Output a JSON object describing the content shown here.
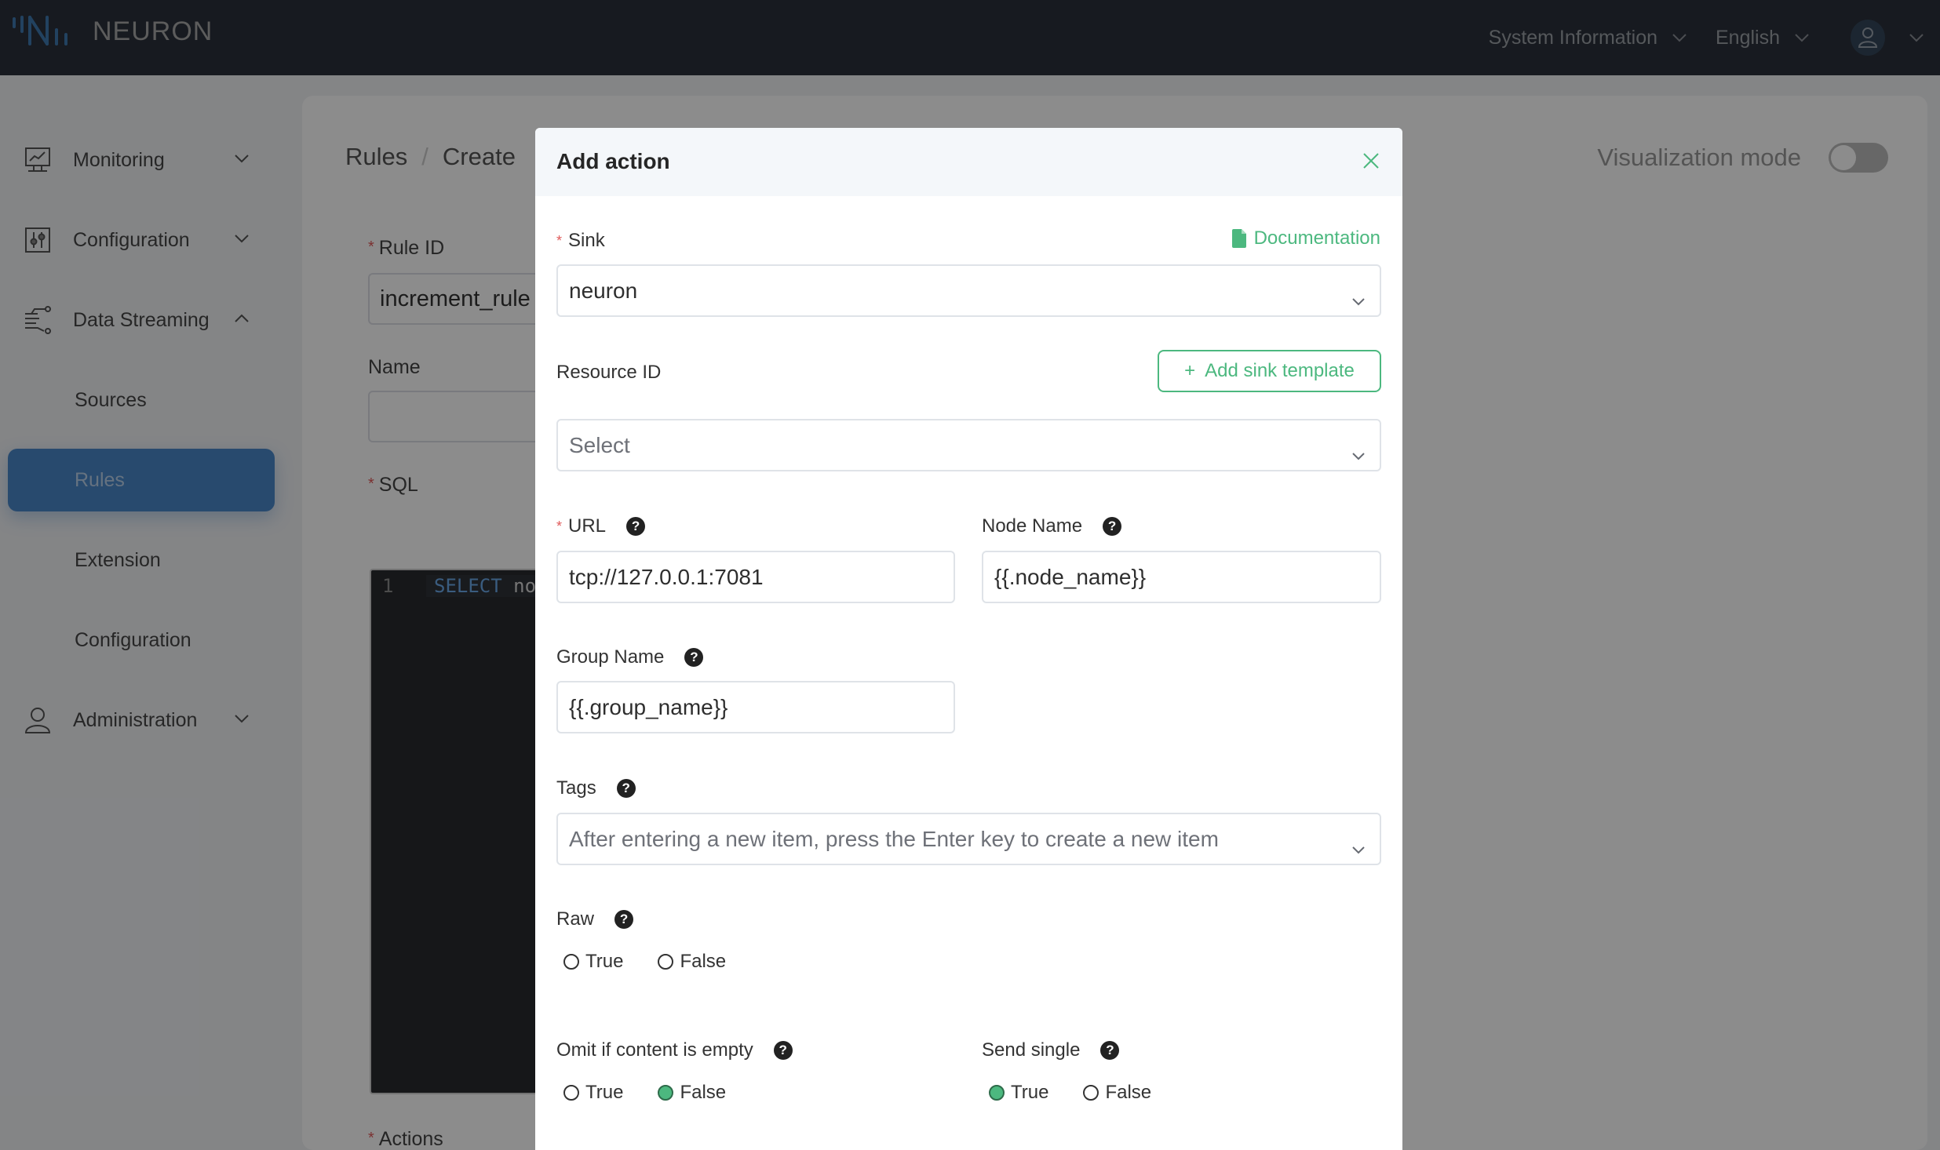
{
  "header": {
    "app_name": "NEURON",
    "menus": [
      {
        "label": "System Information"
      },
      {
        "label": "English"
      }
    ],
    "user_icon": "user-icon"
  },
  "sidebar": {
    "items": [
      {
        "label": "Monitoring",
        "icon": "monitor-chart-icon",
        "expanded": false
      },
      {
        "label": "Configuration",
        "icon": "sliders-icon",
        "expanded": false
      },
      {
        "label": "Data Streaming",
        "icon": "data-stream-icon",
        "expanded": true
      },
      {
        "label": "Sources",
        "sub": true
      },
      {
        "label": "Rules",
        "sub": true,
        "active": true
      },
      {
        "label": "Extension",
        "sub": true
      },
      {
        "label": "Configuration",
        "sub": true
      },
      {
        "label": "Administration",
        "icon": "user-icon",
        "expanded": false
      }
    ]
  },
  "page": {
    "breadcrumb": [
      "Rules",
      "Create"
    ],
    "breadcrumb_sep": "/",
    "visualization_mode_label": "Visualization mode",
    "visualization_mode_on": false,
    "rule_id_label": "Rule ID",
    "rule_id_value": "increment_rule",
    "name_label": "Name",
    "name_value": "",
    "sql_label": "SQL",
    "sql_line_number": "1",
    "sql_keyword": "SELECT",
    "sql_rest": " noc",
    "actions_label": "Actions",
    "required_mark": "*"
  },
  "modal": {
    "title": "Add action",
    "documentation_label": "Documentation",
    "sink_label": "Sink",
    "sink_value": "neuron",
    "resource_id_label": "Resource ID",
    "add_sink_template_label": "Add sink template",
    "resource_id_placeholder": "Select",
    "url_label": "URL",
    "url_value": "tcp://127.0.0.1:7081",
    "node_name_label": "Node Name",
    "node_name_value": "{{.node_name}}",
    "group_name_label": "Group Name",
    "group_name_value": "{{.group_name}}",
    "tags_label": "Tags",
    "tags_placeholder": "After entering a new item, press the Enter key to create a new item",
    "raw_label": "Raw",
    "raw_selected": null,
    "omit_label": "Omit if content is empty",
    "omit_selected": "False",
    "send_single_label": "Send single",
    "send_single_selected": "True",
    "true_label": "True",
    "false_label": "False",
    "help_glyph": "?",
    "required_mark": "*"
  },
  "colors": {
    "accent_green": "#4cb87f",
    "active_nav_blue": "#4a88c9",
    "header_bg": "#2a313b"
  }
}
